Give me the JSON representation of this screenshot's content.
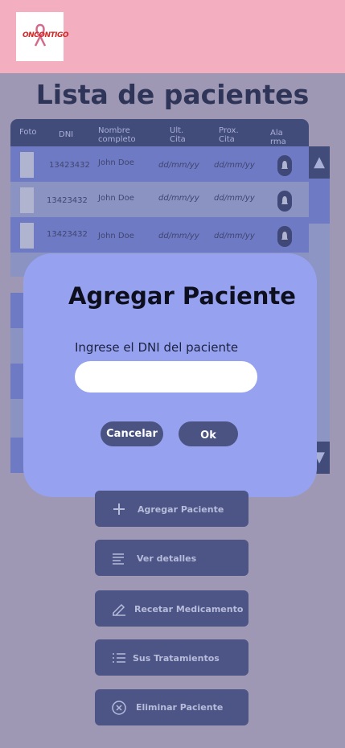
{
  "header": {
    "logo_text": "ONCONTIGO"
  },
  "page_title": "Lista de pacientes",
  "table": {
    "columns": [
      "Foto",
      "DNI",
      "Nombre\ncompleto",
      "Ult.\nCita",
      "Prox.\nCita",
      "Ala\nrma"
    ],
    "rows": [
      {
        "dni": "13423432",
        "name": "John Doe",
        "last": "dd/mm/yy",
        "next": "dd/mm/yy"
      },
      {
        "dni": "13423432",
        "name": "John Doe",
        "last": "dd/mm/yy",
        "next": "dd/mm/yy"
      },
      {
        "dni": "13423432",
        "name": "John Doe",
        "last": "dd/mm/yy",
        "next": "dd/mm/yy"
      }
    ]
  },
  "dialog": {
    "title": "Agregar Paciente",
    "label": "Ingrese el DNI del paciente",
    "input_value": "",
    "input_placeholder": "",
    "cancel_label": "Cancelar",
    "ok_label": "Ok"
  },
  "actions": [
    {
      "label": "Agregar Paciente",
      "icon": "plus-icon"
    },
    {
      "label": "Ver detalles",
      "icon": "lines-icon"
    },
    {
      "label": "Recetar Medicamento",
      "icon": "pencil-icon"
    },
    {
      "label": "Sus Tratamientos",
      "icon": "list-icon"
    },
    {
      "label": "Eliminar Paciente",
      "icon": "close-circle-icon"
    }
  ],
  "colors": {
    "header": "#f3aebf",
    "background": "#9e98b4",
    "dialog": "#96a2ef",
    "button": "#4c5585",
    "table_header": "#424c7a"
  }
}
